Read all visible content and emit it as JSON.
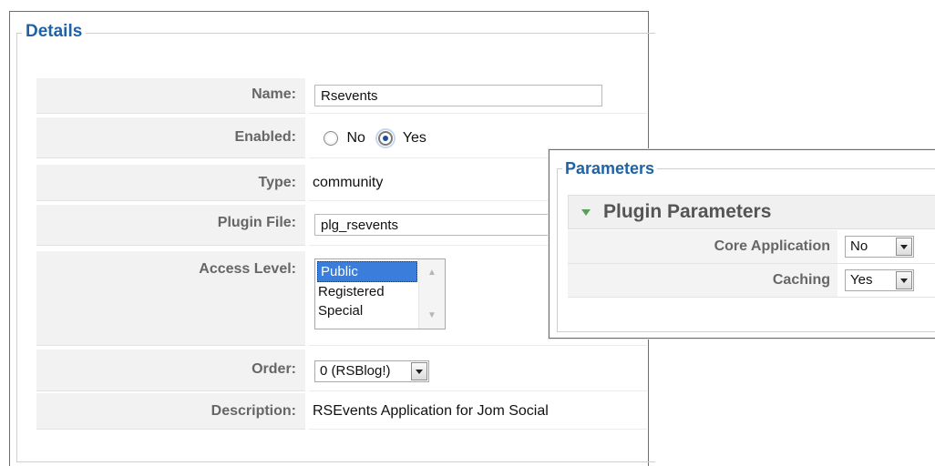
{
  "details": {
    "legend": "Details",
    "name_label": "Name:",
    "name_value": "Rsevents",
    "enabled_label": "Enabled:",
    "enabled_no": "No",
    "enabled_yes": "Yes",
    "enabled_selected": "Yes",
    "type_label": "Type:",
    "type_value": "community",
    "plugin_file_label": "Plugin File:",
    "plugin_file_value": "plg_rsevents",
    "access_level_label": "Access Level:",
    "access_options": [
      "Public",
      "Registered",
      "Special"
    ],
    "access_selected": "Public",
    "order_label": "Order:",
    "order_value": "0 (RSBlog!)",
    "description_label": "Description:",
    "description_value": "RSEvents Application for Jom Social"
  },
  "parameters": {
    "legend": "Parameters",
    "section_title": "Plugin Parameters",
    "core_application_label": "Core Application",
    "core_application_value": "No",
    "caching_label": "Caching",
    "caching_value": "Yes"
  },
  "colors": {
    "legend": "#1f62a6",
    "label_bg": "#f2f2f2",
    "selected_option": "#3a7ddb",
    "section_arrow": "#5aa05a"
  }
}
